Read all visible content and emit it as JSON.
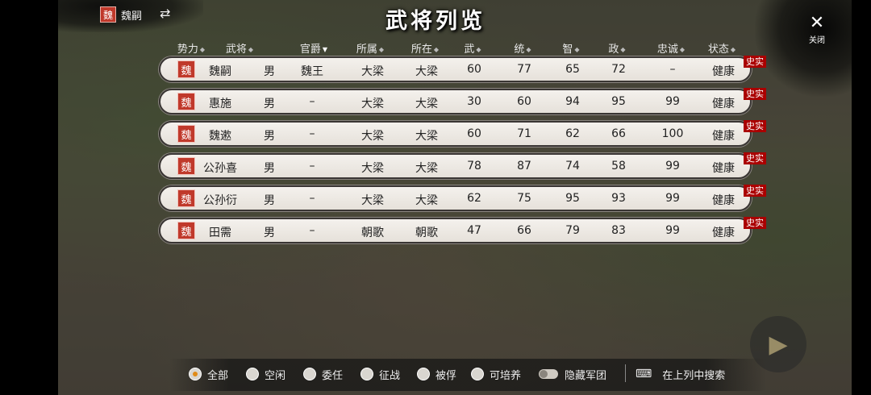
{
  "lord": {
    "badge": "魏",
    "name": "魏嗣",
    "switch_icon": "swap-arrows-icon"
  },
  "title": "武将列览",
  "close": {
    "icon": "✕",
    "label": "关闭"
  },
  "columns": [
    {
      "label": "势力",
      "sortable": true
    },
    {
      "label": "武将",
      "sortable": true
    },
    {
      "label": "官爵",
      "sortable": true,
      "sorted": "desc"
    },
    {
      "label": "所属",
      "sortable": true
    },
    {
      "label": "所在",
      "sortable": true
    },
    {
      "label": "武",
      "sortable": true
    },
    {
      "label": "统",
      "sortable": true
    },
    {
      "label": "智",
      "sortable": true
    },
    {
      "label": "政",
      "sortable": true
    },
    {
      "label": "忠诚",
      "sortable": true
    },
    {
      "label": "状态",
      "sortable": true
    }
  ],
  "rows": [
    {
      "faction": "魏",
      "name": "魏嗣",
      "gender": "男",
      "rank": "魏王",
      "belong": "大梁",
      "location": "大梁",
      "war": "60",
      "lead": "77",
      "intel": "65",
      "pol": "72",
      "loyalty": "–",
      "status": "健康",
      "tag": "史实"
    },
    {
      "faction": "魏",
      "name": "惠施",
      "gender": "男",
      "rank": "–",
      "belong": "大梁",
      "location": "大梁",
      "war": "30",
      "lead": "60",
      "intel": "94",
      "pol": "95",
      "loyalty": "99",
      "status": "健康",
      "tag": "史实"
    },
    {
      "faction": "魏",
      "name": "魏遬",
      "gender": "男",
      "rank": "–",
      "belong": "大梁",
      "location": "大梁",
      "war": "60",
      "lead": "71",
      "intel": "62",
      "pol": "66",
      "loyalty": "100",
      "status": "健康",
      "tag": "史实"
    },
    {
      "faction": "魏",
      "name": "公孙喜",
      "gender": "男",
      "rank": "–",
      "belong": "大梁",
      "location": "大梁",
      "war": "78",
      "lead": "87",
      "intel": "74",
      "pol": "58",
      "loyalty": "99",
      "status": "健康",
      "tag": "史实"
    },
    {
      "faction": "魏",
      "name": "公孙衍",
      "gender": "男",
      "rank": "–",
      "belong": "大梁",
      "location": "大梁",
      "war": "62",
      "lead": "75",
      "intel": "95",
      "pol": "93",
      "loyalty": "99",
      "status": "健康",
      "tag": "史实"
    },
    {
      "faction": "魏",
      "name": "田需",
      "gender": "男",
      "rank": "–",
      "belong": "朝歌",
      "location": "朝歌",
      "war": "47",
      "lead": "66",
      "intel": "79",
      "pol": "83",
      "loyalty": "99",
      "status": "健康",
      "tag": "史实"
    }
  ],
  "filters": [
    {
      "label": "全部",
      "selected": true
    },
    {
      "label": "空闲",
      "selected": false
    },
    {
      "label": "委任",
      "selected": false
    },
    {
      "label": "征战",
      "selected": false
    },
    {
      "label": "被俘",
      "selected": false
    },
    {
      "label": "可培养",
      "selected": false
    }
  ],
  "hide_army": {
    "label": "隐藏军团",
    "on": false
  },
  "search": {
    "label": "在上列中搜索",
    "icon": "keyboard-icon"
  },
  "colors": {
    "faction_red": "#c0392b",
    "tag_red": "#aa0000",
    "accent_orange": "#e08a16"
  }
}
